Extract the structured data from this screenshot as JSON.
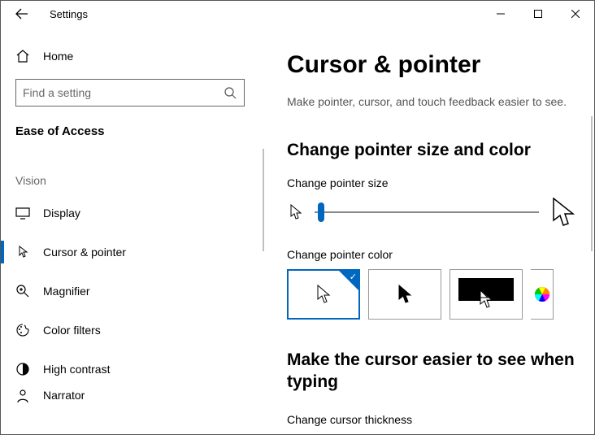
{
  "window": {
    "title": "Settings"
  },
  "sidebar": {
    "home_label": "Home",
    "search_placeholder": "Find a setting",
    "category": "Ease of Access",
    "group": "Vision",
    "items": [
      {
        "label": "Display"
      },
      {
        "label": "Cursor & pointer"
      },
      {
        "label": "Magnifier"
      },
      {
        "label": "Color filters"
      },
      {
        "label": "High contrast"
      },
      {
        "label": "Narrator"
      }
    ]
  },
  "main": {
    "title": "Cursor & pointer",
    "subtitle": "Make pointer, cursor, and touch feedback easier to see.",
    "section1_title": "Change pointer size and color",
    "size_label": "Change pointer size",
    "color_label": "Change pointer color",
    "section2_title": "Make the cursor easier to see when typing",
    "thickness_label": "Change cursor thickness"
  }
}
